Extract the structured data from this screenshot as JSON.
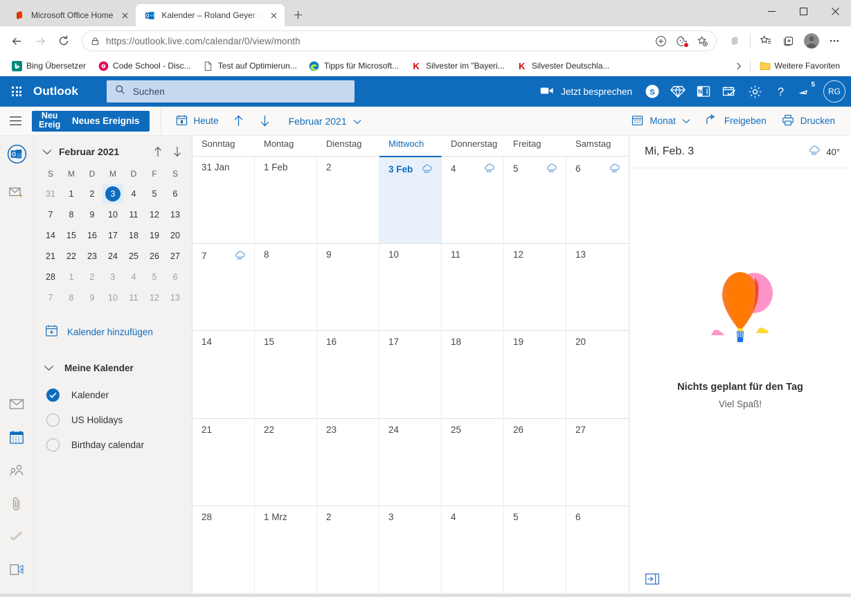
{
  "browser": {
    "tabs": [
      {
        "title": "Microsoft Office Home",
        "favicon": "office-icon",
        "active": false
      },
      {
        "title": "Kalender – Roland Geyer – Outlo",
        "favicon": "outlook-icon",
        "active": true
      }
    ],
    "new_tab_label": "+",
    "window_controls": {
      "minimize": "—",
      "maximize": "☐",
      "close": "✕"
    },
    "nav": {
      "back": "←",
      "forward": "→",
      "refresh": "⟳"
    },
    "address": {
      "scheme_host": "https://outlook.live.com",
      "path": "/calendar/0/view/month",
      "full": "https://outlook.live.com/calendar/0/view/month"
    },
    "omnibox_actions": [
      "add-to-collections-icon",
      "cookies-blocked-icon",
      "favorite-add-icon"
    ],
    "toolbar_right": [
      "office-sidebar-icon",
      "favorites-icon",
      "collections-icon",
      "profile-icon",
      "settings-more-icon"
    ],
    "bookmarks": [
      {
        "label": "Bing Übersetzer",
        "icon": "bing-icon"
      },
      {
        "label": "Code School - Disc...",
        "icon": "codeschool-icon"
      },
      {
        "label": "Test auf Optimierun...",
        "icon": "page-icon"
      },
      {
        "label": "Tipps für Microsoft...",
        "icon": "edge-icon"
      },
      {
        "label": "Silvester im \"Bayeri...",
        "icon": "k-icon"
      },
      {
        "label": "Silvester Deutschla...",
        "icon": "k-icon"
      }
    ],
    "bookmarks_overflow": "›",
    "other_favorites": {
      "label": "Weitere Favoriten",
      "icon": "folder-icon"
    }
  },
  "outlook": {
    "brand": "Outlook",
    "search": {
      "placeholder": "Suchen",
      "icon": "search-icon"
    },
    "meet_now": {
      "label": "Jetzt besprechen",
      "icon": "video-camera-icon"
    },
    "header_icons": [
      {
        "name": "skype-icon",
        "label": "Skype"
      },
      {
        "name": "diamond-premium-icon",
        "label": "Premium"
      },
      {
        "name": "onenote-icon",
        "label": "OneNote"
      },
      {
        "name": "to-do-icon",
        "label": "To Do"
      },
      {
        "name": "gear-icon",
        "label": "Einstellungen"
      },
      {
        "name": "help-icon",
        "label": "Hilfe"
      },
      {
        "name": "feedback-icon",
        "label": "Benachrichtigungen",
        "badge": "5"
      }
    ],
    "avatar": {
      "initials": "RG",
      "color": "#0f6cbd"
    }
  },
  "commandbar": {
    "menu_icon": "hamburger-icon",
    "new_event": {
      "label": "Neues Ereignis",
      "ghost_line1": "Neu",
      "ghost_line2": "Ereig"
    },
    "today": {
      "label": "Heute",
      "icon": "calendar-today-icon"
    },
    "prev": "↑",
    "next": "↓",
    "period": "Februar 2021",
    "period_chevron": "⌄",
    "view": {
      "label": "Monat",
      "icon": "calendar-view-icon",
      "chevron": "⌄"
    },
    "share": {
      "label": "Freigeben",
      "icon": "share-icon"
    },
    "print": {
      "label": "Drucken",
      "icon": "printer-icon"
    }
  },
  "rail": {
    "top": [
      {
        "name": "outlook-logo-icon",
        "selected": false
      },
      {
        "name": "new-mail-icon",
        "selected": false
      }
    ],
    "bottom": [
      {
        "name": "mail-icon",
        "selected": false
      },
      {
        "name": "calendar-icon",
        "selected": true
      },
      {
        "name": "people-icon",
        "selected": false
      },
      {
        "name": "files-icon",
        "selected": false
      },
      {
        "name": "to-do-icon",
        "selected": false
      },
      {
        "name": "skype-meet-icon",
        "selected": false
      }
    ]
  },
  "minical": {
    "title": "Februar 2021",
    "collapse_chevron": "⌄",
    "prev": "↑",
    "next": "↓",
    "dow": [
      "S",
      "M",
      "D",
      "M",
      "D",
      "F",
      "S"
    ],
    "weeks": [
      [
        {
          "d": "31",
          "out": true
        },
        {
          "d": "1"
        },
        {
          "d": "2"
        },
        {
          "d": "3",
          "today": true
        },
        {
          "d": "4"
        },
        {
          "d": "5"
        },
        {
          "d": "6"
        }
      ],
      [
        {
          "d": "7"
        },
        {
          "d": "8"
        },
        {
          "d": "9"
        },
        {
          "d": "10"
        },
        {
          "d": "11"
        },
        {
          "d": "12"
        },
        {
          "d": "13"
        }
      ],
      [
        {
          "d": "14"
        },
        {
          "d": "15"
        },
        {
          "d": "16"
        },
        {
          "d": "17"
        },
        {
          "d": "18"
        },
        {
          "d": "19"
        },
        {
          "d": "20"
        }
      ],
      [
        {
          "d": "21"
        },
        {
          "d": "22"
        },
        {
          "d": "23"
        },
        {
          "d": "24"
        },
        {
          "d": "25"
        },
        {
          "d": "26"
        },
        {
          "d": "27"
        }
      ],
      [
        {
          "d": "28"
        },
        {
          "d": "1",
          "out": true
        },
        {
          "d": "2",
          "out": true
        },
        {
          "d": "3",
          "out": true
        },
        {
          "d": "4",
          "out": true
        },
        {
          "d": "5",
          "out": true
        },
        {
          "d": "6",
          "out": true
        }
      ],
      [
        {
          "d": "7",
          "out": true
        },
        {
          "d": "8",
          "out": true
        },
        {
          "d": "9",
          "out": true
        },
        {
          "d": "10",
          "out": true
        },
        {
          "d": "11",
          "out": true
        },
        {
          "d": "12",
          "out": true
        },
        {
          "d": "13",
          "out": true
        }
      ]
    ]
  },
  "sidebar": {
    "add_calendar": {
      "label": "Kalender hinzufügen",
      "icon": "calendar-add-icon"
    },
    "my_calendars": {
      "label": "Meine Kalender",
      "chevron": "⌄"
    },
    "calendars": [
      {
        "label": "Kalender",
        "checked": true
      },
      {
        "label": "US Holidays",
        "checked": false
      },
      {
        "label": "Birthday calendar",
        "checked": false
      }
    ]
  },
  "grid": {
    "day_names": [
      "Sonntag",
      "Montag",
      "Dienstag",
      "Mittwoch",
      "Donnerstag",
      "Freitag",
      "Samstag"
    ],
    "current_day_index": 3,
    "weeks": [
      [
        {
          "label": "31 Jan"
        },
        {
          "label": "1 Feb"
        },
        {
          "label": "2"
        },
        {
          "label": "3 Feb",
          "today": true,
          "weather": "rain-cloud-icon"
        },
        {
          "label": "4",
          "weather": "rain-cloud-icon"
        },
        {
          "label": "5",
          "weather": "rain-cloud-icon"
        },
        {
          "label": "6",
          "weather": "rain-cloud-icon"
        }
      ],
      [
        {
          "label": "7",
          "weather": "rain-cloud-icon"
        },
        {
          "label": "8"
        },
        {
          "label": "9"
        },
        {
          "label": "10"
        },
        {
          "label": "11"
        },
        {
          "label": "12"
        },
        {
          "label": "13"
        }
      ],
      [
        {
          "label": "14"
        },
        {
          "label": "15"
        },
        {
          "label": "16"
        },
        {
          "label": "17"
        },
        {
          "label": "18"
        },
        {
          "label": "19"
        },
        {
          "label": "20"
        }
      ],
      [
        {
          "label": "21"
        },
        {
          "label": "22"
        },
        {
          "label": "23"
        },
        {
          "label": "24"
        },
        {
          "label": "25"
        },
        {
          "label": "26"
        },
        {
          "label": "27"
        }
      ],
      [
        {
          "label": "28"
        },
        {
          "label": "1 Mrz"
        },
        {
          "label": "2"
        },
        {
          "label": "3"
        },
        {
          "label": "4"
        },
        {
          "label": "5"
        },
        {
          "label": "6"
        }
      ]
    ]
  },
  "agenda": {
    "date": "Mi, Feb. 3",
    "weather": {
      "icon": "rain-cloud-icon",
      "temp": "40°"
    },
    "empty_title": "Nichts geplant für den Tag",
    "empty_sub": "Viel Spaß!",
    "illustration": "hot-air-balloon-illustration",
    "footer_icon": "collapse-panel-icon"
  }
}
